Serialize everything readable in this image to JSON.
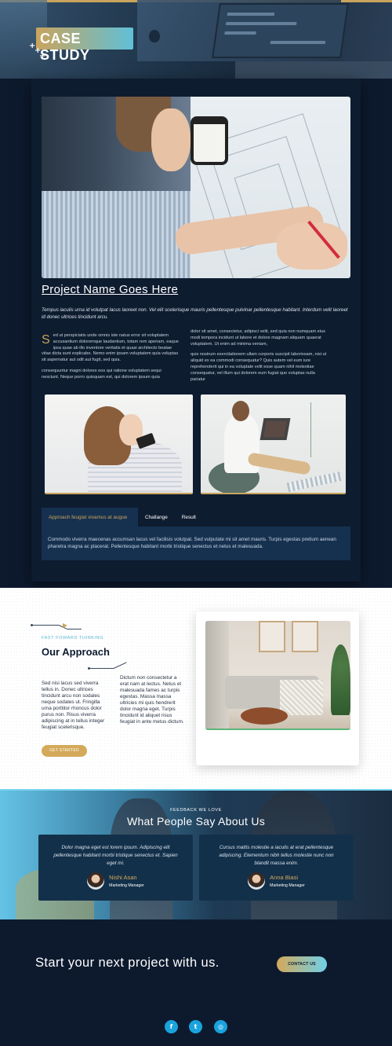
{
  "hero": {
    "badge": "CASE STUDY"
  },
  "project": {
    "title": "Project Name Goes Here",
    "intro": "Tempus iaculis urna id volutpat lacus laoreet non. Vel elit scelerisque mauris pellentesque pulvinar pellentesque habitant. Interdum velit laoreet id donec ultrices tincidunt arcu.",
    "dropcap": "S",
    "col1_p1": "ed ut perspiciatis unde omnis iste natus error sit voluptatem accusantium doloremque laudantium, totam rem aperiam, eaque ipsa quae ab illo inventore veritatis et quasi architecto beatae vitae dicta sunt explicabo. Nemo enim ipsam voluptatem quia voluptas sit aspernatur aut odit aut fugit, sed quia.",
    "col1_p2": "consequuntur magni dolores eos qui ratione voluptatem sequi nesciunt. Neque porro quisquam est, qui dolorem ipsum quia",
    "col2_p1": "dolor sit amet, consectetur, adipisci velit, sed quia non numquam eius modi tempora incidunt ut labore et dolore magnam aliquam quaerat voluptatem. Ut enim ad minima veniam,",
    "col2_p2": "quis nostrum exercitationem ullam corporis suscipit laboriosam, nisi ut aliquid ex ea commodi consequatur? Quis autem vel eum iure reprehenderit qui in ea voluptate velit esse quam nihil molestiae consequatur, vel illum qui dolorem eum fugiat quo voluptas nulla pariatur"
  },
  "tabs": {
    "items": [
      "Approach feugiat vivamus at augue",
      "Challange",
      "Result"
    ],
    "active": 0,
    "panel": "Commodo viverra maecenas accumsan lacus vel facilisis volutpat. Sed vulputate mi sit amet mauris. Turpis egestas pretium aenean pharetra magna ac placerat. Pellentesque habitant morbi tristique senectus et netus et malesuada."
  },
  "approach": {
    "kicker": "FAST FOWARD THINKING",
    "title": "Our Approach",
    "col1": "Sed nisi lacus sed viverra tellus in. Donec ultrices tincidunt arcu non sodales neque sodales ut. Fringilla urna porttitor rhoncus dolor purus non. Risus viverra adipiscing at in tellus integer feugiat scelerisque.",
    "col2": "Dictum non consectetur a erat nam at lectus. Netus et malesuada fames ac turpis egestas. Massa massa ultricies mi quis hendrerit dolor magna eget. Turpis tincidunt id aliquet risus feugiat in ante metus dictum.",
    "button": "GET STARTED"
  },
  "testimonials": {
    "kicker": "FEEDBACK WE LOVE",
    "title": "What People Say About Us",
    "items": [
      {
        "quote": "Dolor magna eget est lorem ipsum. Adipiscing elit pellentesque habitant morbi tristique senectus et. Sapien eget mi.",
        "name": "Nishi Asan",
        "role": "Marketing Manager"
      },
      {
        "quote": "Cursus mattis molestie a iaculis at erat pellentesque adipiscing. Elementum nibh tellus molestie nunc non blandit massa enim.",
        "name": "Anna Biasi",
        "role": "Marketing Manager"
      }
    ]
  },
  "cta": {
    "title": "Start your next project with us.",
    "button": "CONTACT US"
  },
  "footer": {
    "social": [
      {
        "icon": "facebook-icon",
        "glyph": "f"
      },
      {
        "icon": "twitter-icon",
        "glyph": "t"
      },
      {
        "icon": "instagram-icon",
        "glyph": "◎"
      }
    ]
  },
  "colors": {
    "navy": "#0d1a2e",
    "gold": "#c9a45c",
    "cyan": "#5bb7cf",
    "tab_bg": "#163150"
  }
}
